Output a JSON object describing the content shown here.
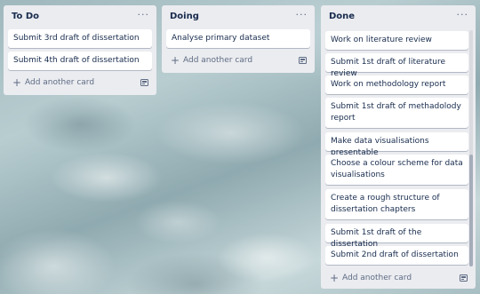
{
  "lists": [
    {
      "title": "To Do",
      "menu": "···",
      "cards": [
        "Submit 3rd draft of dissertation",
        "Submit 4th draft of dissertation"
      ],
      "add_label": "Add another card"
    },
    {
      "title": "Doing",
      "menu": "···",
      "cards": [
        "Analyse primary dataset"
      ],
      "add_label": "Add another card"
    },
    {
      "title": "Done",
      "menu": "···",
      "cards": [
        "Work on literature review",
        "Submit 1st draft of literature review",
        "Work on methodology report",
        "Submit 1st draft of methadolody report",
        "Make data visualisations presentable",
        "Choose a colour scheme for data visualisations",
        "Create a rough structure of dissertation chapters",
        "Submit 1st draft of the dissertation",
        "Submit 2nd draft of dissertation"
      ],
      "add_label": "Add another card"
    }
  ],
  "icons": {
    "add": "plus-icon",
    "template": "card-template-icon",
    "menu": "more-horizontal-icon"
  },
  "colors": {
    "list_bg": "#ebecf0",
    "card_bg": "#ffffff",
    "text": "#172b4d",
    "muted": "#5e6c84"
  }
}
